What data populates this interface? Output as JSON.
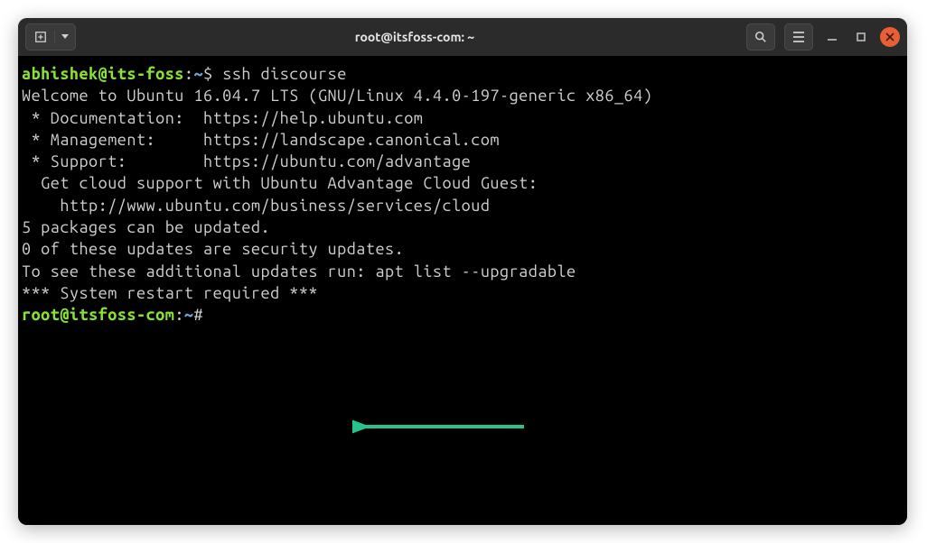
{
  "window": {
    "title": "root@itsfoss-com: ~"
  },
  "prompt1": {
    "user": "abhishek",
    "at": "@",
    "host": "its-foss",
    "colon": ":",
    "path": "~",
    "symbol": "$ ",
    "command": "ssh discourse"
  },
  "motd": {
    "welcome": "Welcome to Ubuntu 16.04.7 LTS (GNU/Linux 4.4.0-197-generic x86_64)",
    "blank1": "",
    "doc": " * Documentation:  https://help.ubuntu.com",
    "mgmt": " * Management:     https://landscape.canonical.com",
    "support": " * Support:        https://ubuntu.com/advantage",
    "blank2": "",
    "cloud1": "  Get cloud support with Ubuntu Advantage Cloud Guest:",
    "cloud2": "    http://www.ubuntu.com/business/services/cloud",
    "blank3": "",
    "pkg1": "5 packages can be updated.",
    "pkg2": "0 of these updates are security updates.",
    "pkg3": "To see these additional updates run: apt list --upgradable",
    "blank4": "",
    "blank5": "",
    "restart": "*** System restart required ***"
  },
  "prompt2": {
    "user": "root",
    "at": "@",
    "host": "itsfoss-com",
    "colon": ":",
    "path": "~",
    "symbol": "#"
  }
}
